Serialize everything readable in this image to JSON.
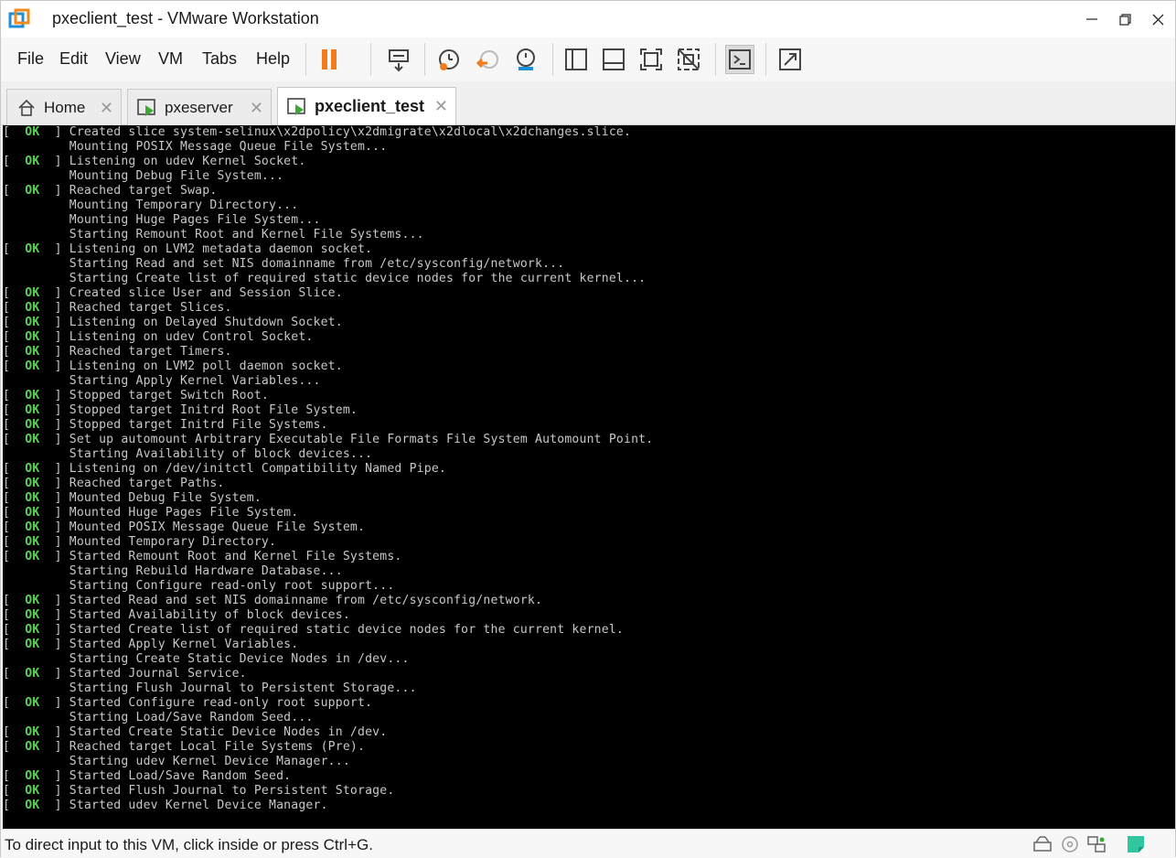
{
  "window": {
    "title": "pxeclient_test - VMware Workstation"
  },
  "menu": [
    "File",
    "Edit",
    "View",
    "VM",
    "Tabs",
    "Help"
  ],
  "tabs": [
    {
      "label": "Home",
      "active": false
    },
    {
      "label": "pxeserver",
      "active": false
    },
    {
      "label": "pxeclient_test",
      "active": true
    }
  ],
  "console": {
    "ok_label": "OK",
    "lines": [
      {
        "ok": true,
        "text": "Created slice system-selinux\\x2dpolicy\\x2dmigrate\\x2dlocal\\x2dchanges.slice."
      },
      {
        "ok": false,
        "text": "Mounting POSIX Message Queue File System..."
      },
      {
        "ok": true,
        "text": "Listening on udev Kernel Socket."
      },
      {
        "ok": false,
        "text": "Mounting Debug File System..."
      },
      {
        "ok": true,
        "text": "Reached target Swap."
      },
      {
        "ok": false,
        "text": "Mounting Temporary Directory..."
      },
      {
        "ok": false,
        "text": "Mounting Huge Pages File System..."
      },
      {
        "ok": false,
        "text": "Starting Remount Root and Kernel File Systems..."
      },
      {
        "ok": true,
        "text": "Listening on LVM2 metadata daemon socket."
      },
      {
        "ok": false,
        "text": "Starting Read and set NIS domainname from /etc/sysconfig/network..."
      },
      {
        "ok": false,
        "text": "Starting Create list of required static device nodes for the current kernel..."
      },
      {
        "ok": true,
        "text": "Created slice User and Session Slice."
      },
      {
        "ok": true,
        "text": "Reached target Slices."
      },
      {
        "ok": true,
        "text": "Listening on Delayed Shutdown Socket."
      },
      {
        "ok": true,
        "text": "Listening on udev Control Socket."
      },
      {
        "ok": true,
        "text": "Reached target Timers."
      },
      {
        "ok": true,
        "text": "Listening on LVM2 poll daemon socket."
      },
      {
        "ok": false,
        "text": "Starting Apply Kernel Variables..."
      },
      {
        "ok": true,
        "text": "Stopped target Switch Root."
      },
      {
        "ok": true,
        "text": "Stopped target Initrd Root File System."
      },
      {
        "ok": true,
        "text": "Stopped target Initrd File Systems."
      },
      {
        "ok": true,
        "text": "Set up automount Arbitrary Executable File Formats File System Automount Point."
      },
      {
        "ok": false,
        "text": "Starting Availability of block devices..."
      },
      {
        "ok": true,
        "text": "Listening on /dev/initctl Compatibility Named Pipe."
      },
      {
        "ok": true,
        "text": "Reached target Paths."
      },
      {
        "ok": true,
        "text": "Mounted Debug File System."
      },
      {
        "ok": true,
        "text": "Mounted Huge Pages File System."
      },
      {
        "ok": true,
        "text": "Mounted POSIX Message Queue File System."
      },
      {
        "ok": true,
        "text": "Mounted Temporary Directory."
      },
      {
        "ok": true,
        "text": "Started Remount Root and Kernel File Systems."
      },
      {
        "ok": false,
        "text": "Starting Rebuild Hardware Database..."
      },
      {
        "ok": false,
        "text": "Starting Configure read-only root support..."
      },
      {
        "ok": true,
        "text": "Started Read and set NIS domainname from /etc/sysconfig/network."
      },
      {
        "ok": true,
        "text": "Started Availability of block devices."
      },
      {
        "ok": true,
        "text": "Started Create list of required static device nodes for the current kernel."
      },
      {
        "ok": true,
        "text": "Started Apply Kernel Variables."
      },
      {
        "ok": false,
        "text": "Starting Create Static Device Nodes in /dev..."
      },
      {
        "ok": true,
        "text": "Started Journal Service."
      },
      {
        "ok": false,
        "text": "Starting Flush Journal to Persistent Storage..."
      },
      {
        "ok": true,
        "text": "Started Configure read-only root support."
      },
      {
        "ok": false,
        "text": "Starting Load/Save Random Seed..."
      },
      {
        "ok": true,
        "text": "Started Create Static Device Nodes in /dev."
      },
      {
        "ok": true,
        "text": "Reached target Local File Systems (Pre)."
      },
      {
        "ok": false,
        "text": "Starting udev Kernel Device Manager..."
      },
      {
        "ok": true,
        "text": "Started Load/Save Random Seed."
      },
      {
        "ok": true,
        "text": "Started Flush Journal to Persistent Storage."
      },
      {
        "ok": true,
        "text": "Started udev Kernel Device Manager."
      }
    ]
  },
  "status": {
    "text": "To direct input to this VM, click inside or press Ctrl+G."
  },
  "colors": {
    "ok_green": "#55d655",
    "console_bg": "#000000",
    "console_text": "#c8c8c8",
    "accent_orange": "#f07c1c"
  }
}
